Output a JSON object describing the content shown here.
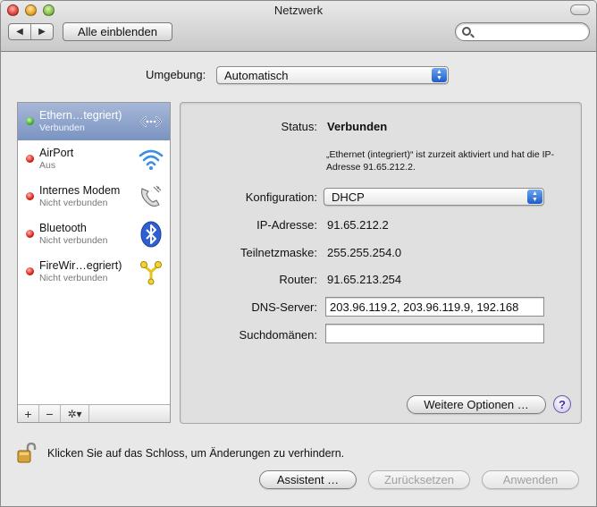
{
  "window": {
    "title": "Netzwerk"
  },
  "toolbar": {
    "back_glyph": "◀",
    "forward_glyph": "▶",
    "show_all_label": "Alle einblenden",
    "search_value": "",
    "search_placeholder": ""
  },
  "location": {
    "label": "Umgebung:",
    "value": "Automatisch"
  },
  "services": [
    {
      "name": "Ethern…tegriert)",
      "status": "Verbunden",
      "status_color": "green",
      "icon": "ethernet-icon",
      "selected": true
    },
    {
      "name": "AirPort",
      "status": "Aus",
      "status_color": "red",
      "icon": "airport-wifi-icon",
      "selected": false
    },
    {
      "name": "Internes Modem",
      "status": "Nicht verbunden",
      "status_color": "red",
      "icon": "modem-phone-icon",
      "selected": false
    },
    {
      "name": "Bluetooth",
      "status": "Nicht verbunden",
      "status_color": "red",
      "icon": "bluetooth-icon",
      "selected": false
    },
    {
      "name": "FireWir…egriert)",
      "status": "Nicht verbunden",
      "status_color": "red",
      "icon": "firewire-icon",
      "selected": false
    }
  ],
  "sidebar_footer": {
    "add": "+",
    "remove": "−",
    "action": "✲▾"
  },
  "detail": {
    "status_label": "Status:",
    "status_value": "Verbunden",
    "status_note": "„Ethernet (integriert)“ ist zurzeit aktiviert und hat die IP-Adresse 91.65.212.2.",
    "config_label": "Konfiguration:",
    "config_value": "DHCP",
    "ip_label": "IP-Adresse:",
    "ip_value": "91.65.212.2",
    "subnet_label": "Teilnetzmaske:",
    "subnet_value": "255.255.254.0",
    "router_label": "Router:",
    "router_value": "91.65.213.254",
    "dns_label": "DNS-Server:",
    "dns_value": "203.96.119.2, 203.96.119.9, 192.168",
    "search_domains_label": "Suchdomänen:",
    "search_domains_value": "",
    "more_options_label": "Weitere Optionen …",
    "help_label": "?"
  },
  "footer": {
    "lock_text": "Klicken Sie auf das Schloss, um Änderungen zu verhindern.",
    "assistant_label": "Assistent …",
    "revert_label": "Zurücksetzen",
    "apply_label": "Anwenden"
  },
  "colors": {
    "selection": "#7a93c1",
    "status_green": "#3cae2e",
    "status_red": "#d81e14",
    "popup_arrow_blue": "#1f5cc9"
  }
}
